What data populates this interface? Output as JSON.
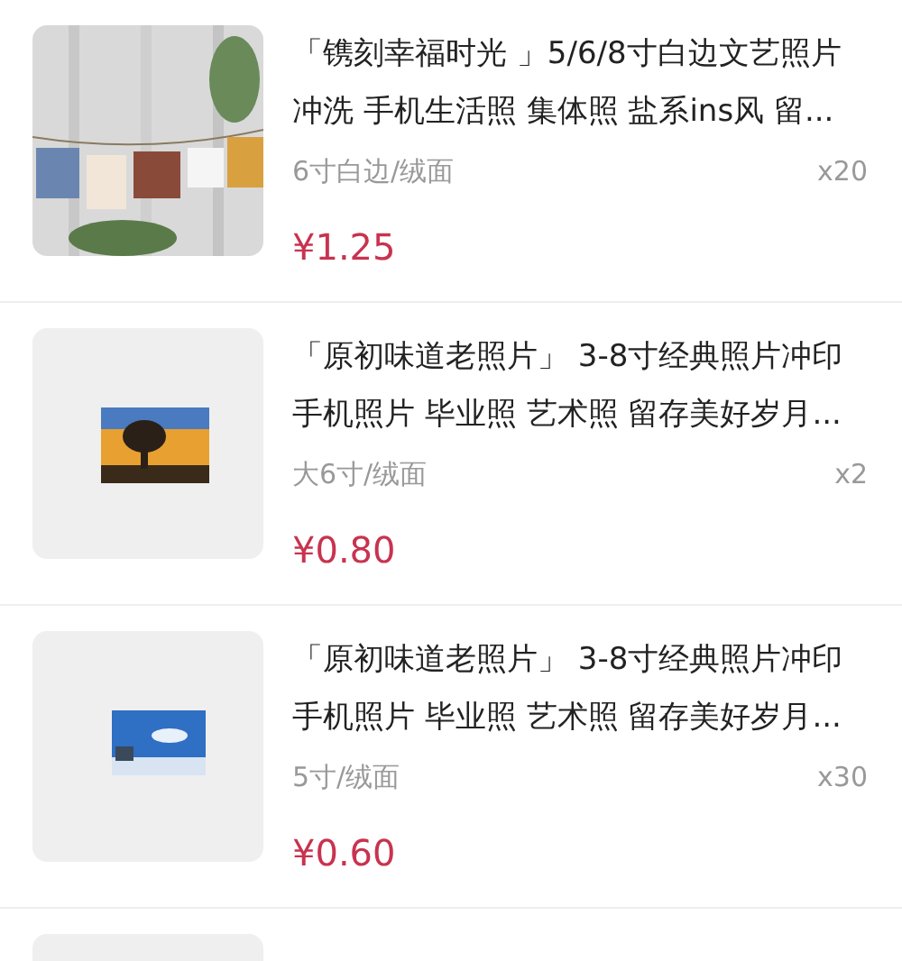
{
  "items": [
    {
      "kind": "collage",
      "title": [
        "「镌刻幸福时光 」5/6/8寸白边文艺照片",
        "冲洗 手机生活照 集体照 盐系ins风 留..."
      ],
      "variant": "6寸白边/绒面",
      "quantity": "x20",
      "price": "¥1.25"
    },
    {
      "kind": "sunset",
      "title": [
        "「原初味道老照片」 3-8寸经典照片冲印",
        "手机照片 毕业照 艺术照 留存美好岁月..."
      ],
      "variant": "大6寸/绒面",
      "quantity": "x2",
      "price": "¥0.80"
    },
    {
      "kind": "sky",
      "title": [
        "「原初味道老照片」 3-8寸经典照片冲印",
        "手机照片 毕业照 艺术照 留存美好岁月..."
      ],
      "variant": "5寸/绒面",
      "quantity": "x30",
      "price": "¥0.60"
    },
    {
      "kind": "plain"
    }
  ]
}
